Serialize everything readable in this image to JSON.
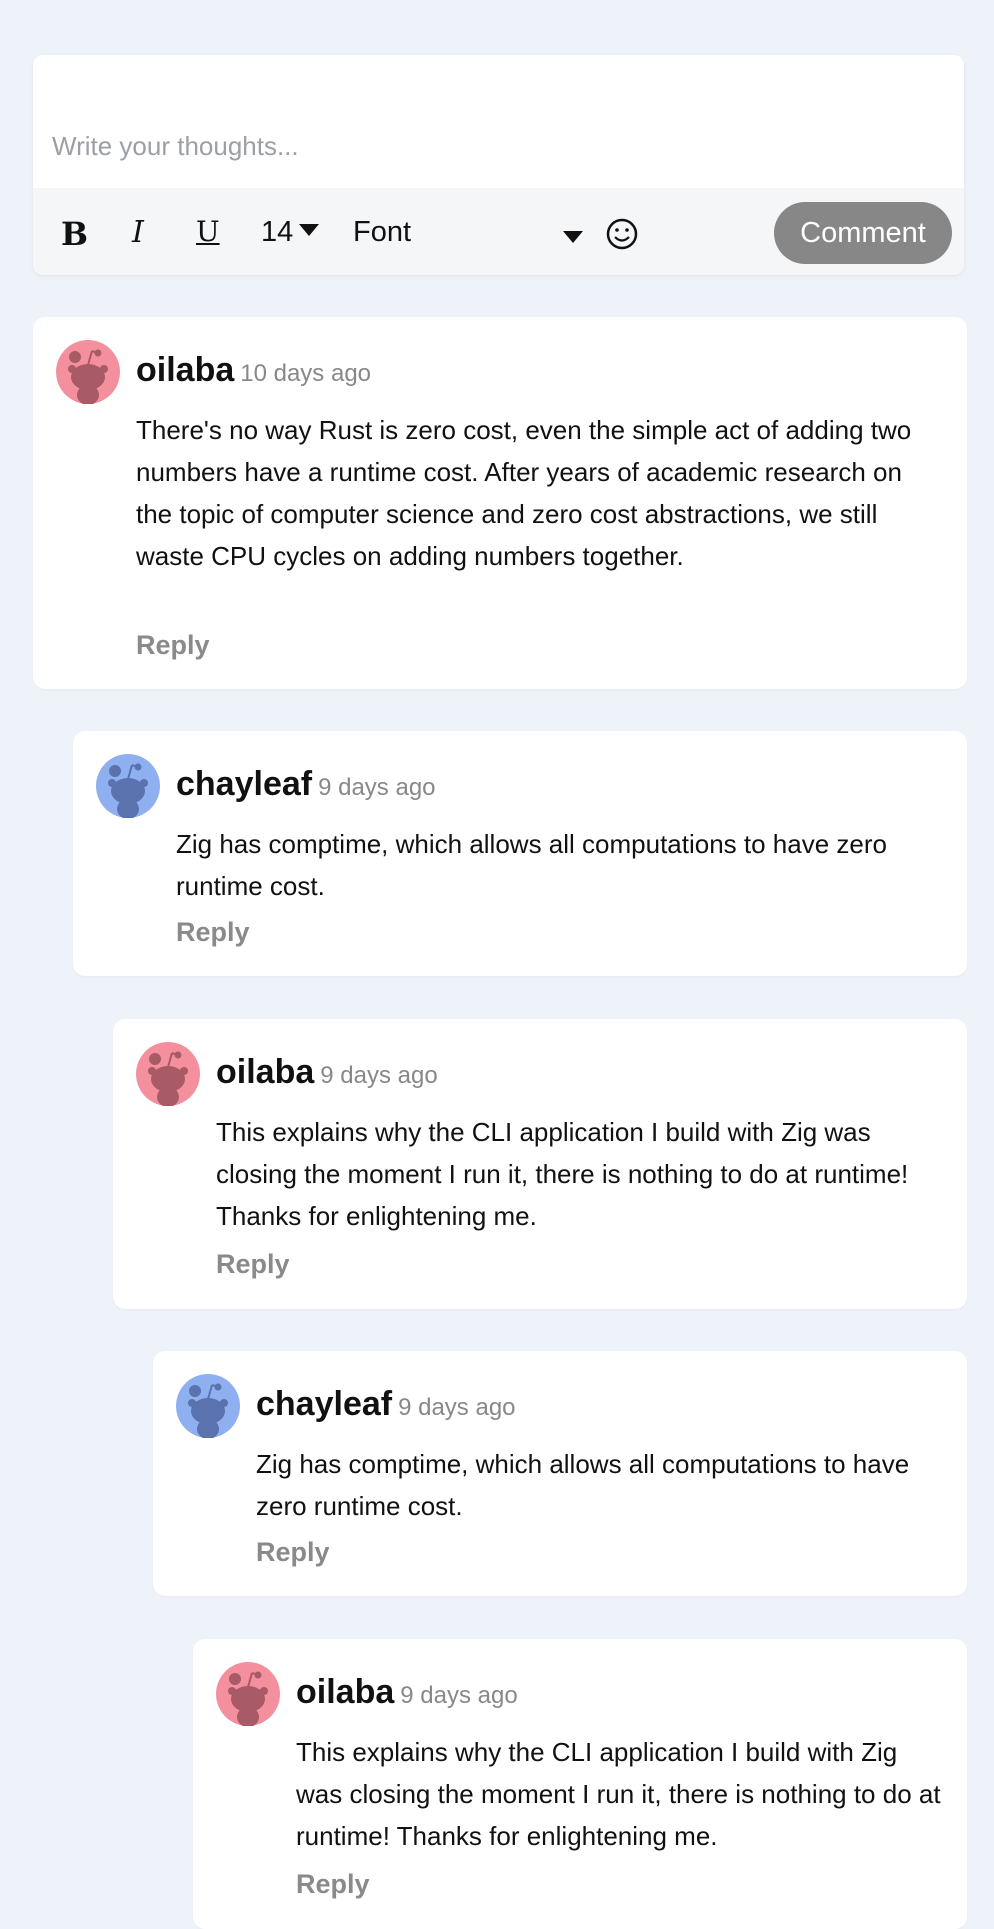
{
  "editor": {
    "placeholder": "Write your thoughts...",
    "bold_label": "B",
    "italic_label": "I",
    "underline_label": "U",
    "font_size": "14",
    "font_label": "Font",
    "emoji_icon": "smiley-icon",
    "comment_button": "Comment"
  },
  "colors": {
    "avatar_pink": "#f4909e",
    "avatar_blue": "#8fb0f0",
    "button_gray": "#878787"
  },
  "comments": [
    {
      "username": "oilaba",
      "time": "10 days ago",
      "text": "There's no way Rust is zero cost, even the simple act of adding two numbers have a runtime cost. After years of academic research on the topic of computer science and zero cost abstractions, we still waste CPU cycles on adding numbers together.",
      "reply": "Reply",
      "avatar_color": "pink"
    },
    {
      "username": "chayleaf",
      "time": "9 days ago",
      "text": "Zig has comptime, which allows all computations to have zero runtime cost.",
      "reply": "Reply",
      "avatar_color": "blue"
    },
    {
      "username": "oilaba",
      "time": "9 days ago",
      "text": "This explains why the CLI application I build with Zig was closing the moment I run it, there is nothing to do at runtime! Thanks for enlightening me.",
      "reply": "Reply",
      "avatar_color": "pink"
    },
    {
      "username": "chayleaf",
      "time": "9 days ago",
      "text": "Zig has comptime, which allows all computations to have zero runtime cost.",
      "reply": "Reply",
      "avatar_color": "blue"
    },
    {
      "username": "oilaba",
      "time": "9 days ago",
      "text": "This explains why the CLI application I build with Zig was closing the moment I run it, there is nothing to do at runtime! Thanks for enlightening me.",
      "reply": "Reply",
      "avatar_color": "pink"
    }
  ]
}
